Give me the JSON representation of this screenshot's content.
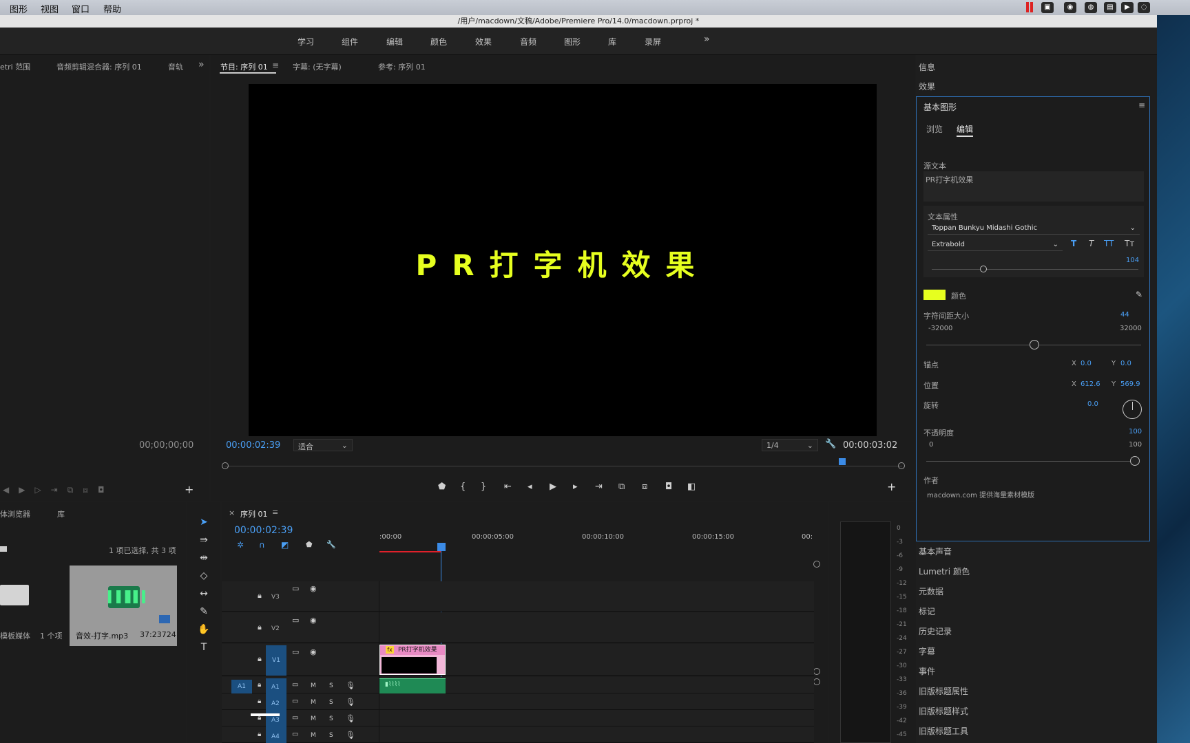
{
  "menu": [
    "图形",
    "视图",
    "窗口",
    "帮助"
  ],
  "title": "/用户/macdown/文稿/Adobe/Premiere Pro/14.0/macdown.prproj *",
  "workspaces": [
    "学习",
    "组件",
    "编辑",
    "颜色",
    "效果",
    "音频",
    "图形",
    "库",
    "录屏"
  ],
  "left_tabs": [
    "etri 范围",
    "音频剪辑混合器: 序列 01",
    "音轨"
  ],
  "left_time": "00;00;00;00",
  "program_tabs": [
    "节目: 序列 01",
    "字幕: (无字幕)",
    "参考: 序列 01"
  ],
  "video_text": "PR打字机效果",
  "program": {
    "current": "00:00:02:39",
    "fit": "适合",
    "quality": "1/4",
    "duration": "00:00:03:02"
  },
  "project": {
    "tabs": [
      "体浏览器",
      "库"
    ],
    "selection": "1 项已选择, 共 3 项",
    "folder_label": "模板媒体",
    "folder_count": "1 个项",
    "clip_name": "音效-打字.mp3",
    "clip_duration": "37:23724"
  },
  "timeline": {
    "tab": "序列 01",
    "time": "00:00:02:39",
    "ruler": [
      ":00:00",
      "00:00:05:00",
      "00:00:10:00",
      "00:00:15:00",
      "00:"
    ],
    "tracks": {
      "V3": "V3",
      "V2": "V2",
      "V1": "V1",
      "A1": "A1",
      "A2": "A2",
      "A3": "A3",
      "A4": "A4",
      "src": "A1"
    },
    "clip_title": "PR打字机效果",
    "m": "M",
    "s": "S"
  },
  "meter_labels": [
    "0",
    "-3",
    "-6",
    "-9",
    "-12",
    "-15",
    "-18",
    "-21",
    "-24",
    "-27",
    "-30",
    "-33",
    "-36",
    "-39",
    "-42",
    "-45"
  ],
  "eg": {
    "info": "信息",
    "effects": "效果",
    "title": "基本图形",
    "tab_browse": "浏览",
    "tab_edit": "编辑",
    "source_text_label": "源文本",
    "source_text": "PR打字机效果",
    "text_props": "文本属性",
    "font": "Toppan Bunkyu Midashi Gothic",
    "style": "Extrabold",
    "size": "104",
    "color_label": "颜色",
    "color": "#e6ff1f",
    "tracking_label": "字符间距大小",
    "tracking": "44",
    "tracking_min": "-32000",
    "tracking_max": "32000",
    "anchor_label": "锚点",
    "anchor_x": "0.0",
    "anchor_y": "0.0",
    "position_label": "位置",
    "pos_x": "612.6",
    "pos_y": "569.9",
    "rotation_label": "旋转",
    "rotation": "0.0",
    "opacity_label": "不透明度",
    "opacity": "100",
    "op_min": "0",
    "op_max": "100",
    "author_label": "作者",
    "author": "macdown.com 提供海量素材模版",
    "x": "X",
    "y": "Y"
  },
  "sections": [
    "基本声音",
    "Lumetri 颜色",
    "元数据",
    "标记",
    "历史记录",
    "字幕",
    "事件",
    "旧版标题属性",
    "旧版标题样式",
    "旧版标题工具"
  ]
}
